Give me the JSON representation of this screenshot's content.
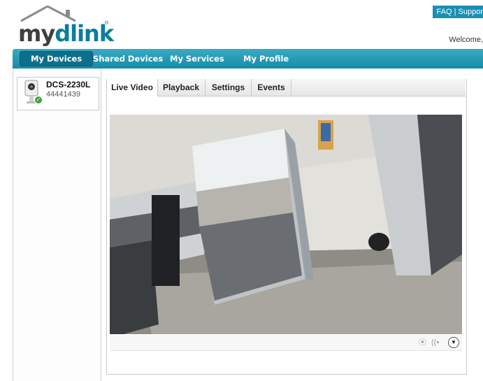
{
  "brand": {
    "my": "my",
    "dlink": "dlink",
    "tm": "®"
  },
  "topbar": {
    "links": [
      "FAQ",
      "Suppor"
    ],
    "separator": "|"
  },
  "welcome": "Welcome,",
  "nav": {
    "items": [
      "My Devices",
      "Shared Devices",
      "My Services",
      "My Profile"
    ],
    "active": "My Devices"
  },
  "device": {
    "name": "DCS-2230L",
    "id": "44441439",
    "status": "online"
  },
  "tabs": {
    "items": [
      "Live Video",
      "Playback",
      "Settings",
      "Events"
    ],
    "active": "Live Video"
  },
  "controls": {
    "record_icon": "record-icon",
    "audio_icon": "audio-icon",
    "menu_icon": "chevron-down-icon"
  },
  "colors": {
    "nav": "#1b8fb3",
    "nav_active": "#0d6f89",
    "brand_blue": "#0b7d9c",
    "status_green": "#3ca63c"
  }
}
